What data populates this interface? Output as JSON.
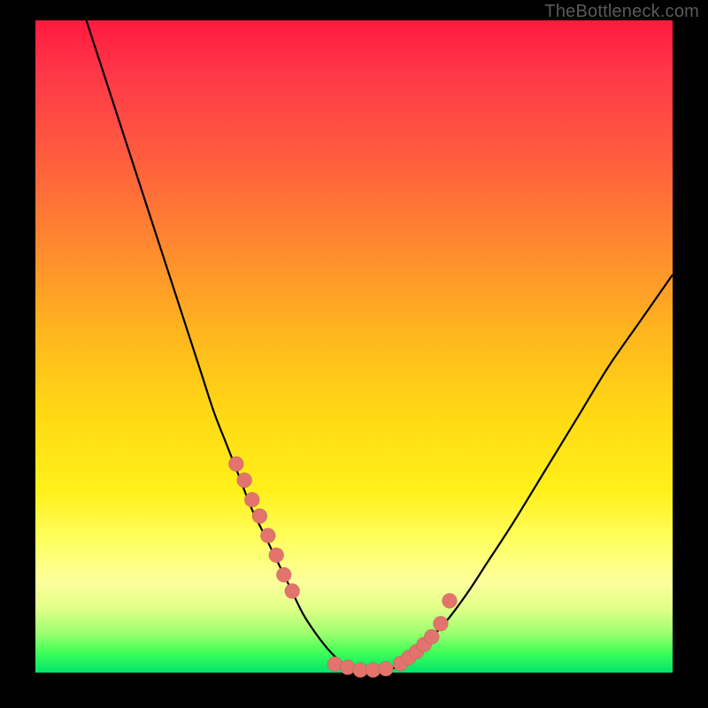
{
  "watermark": "TheBottleneck.com",
  "chart_data": {
    "type": "line",
    "title": "",
    "xlabel": "",
    "ylabel": "",
    "xlim": [
      0,
      100
    ],
    "ylim": [
      0,
      100
    ],
    "grid": false,
    "series": [
      {
        "name": "bottleneck-curve",
        "x": [
          8,
          10,
          12,
          14,
          16,
          18,
          20,
          22,
          24,
          26,
          28,
          30,
          32,
          34,
          36,
          38,
          40,
          42,
          44,
          46,
          48,
          50,
          52,
          54,
          56,
          58,
          60,
          62,
          65,
          68,
          71,
          75,
          80,
          85,
          90,
          95,
          100
        ],
        "y": [
          100,
          94,
          88,
          82,
          76,
          70,
          64,
          58,
          52,
          46,
          40,
          35,
          30,
          25,
          21,
          17,
          13,
          9,
          6,
          3.5,
          1.6,
          0.6,
          0.3,
          0.3,
          0.6,
          1.6,
          3.2,
          5.2,
          8.5,
          12.5,
          17,
          23,
          31,
          39,
          47,
          54,
          61
        ]
      }
    ],
    "points": {
      "name": "markers",
      "x": [
        31.5,
        32.8,
        34.0,
        35.2,
        36.5,
        37.8,
        39.0,
        40.3,
        47.0,
        49.0,
        51.0,
        53.0,
        55.0,
        57.3,
        58.6,
        59.8,
        61.0,
        62.2,
        63.6,
        65.0
      ],
      "y": [
        32.0,
        29.5,
        26.5,
        24.0,
        21.0,
        18.0,
        15.0,
        12.5,
        1.3,
        0.8,
        0.4,
        0.4,
        0.6,
        1.4,
        2.3,
        3.2,
        4.3,
        5.5,
        7.5,
        11.0
      ]
    },
    "background_gradient": {
      "top": "#ff1a3f",
      "mid": "#ffd814",
      "bottom": "#00e46a"
    }
  }
}
